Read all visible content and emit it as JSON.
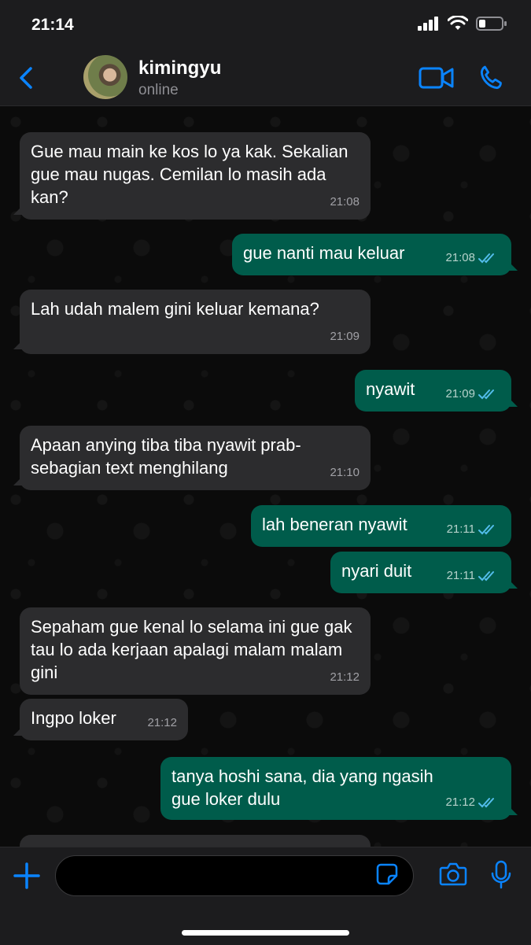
{
  "status_bar": {
    "time": "21:14"
  },
  "header": {
    "contact_name": "kimingyu",
    "status": "online"
  },
  "messages": [
    {
      "dir": "in",
      "text": "Gue mau main ke kos lo ya kak. Sekalian gue mau nugas. Cemilan lo masih ada kan?",
      "time": "21:08"
    },
    {
      "dir": "out",
      "text": "gue nanti mau keluar",
      "time": "21:08",
      "read": true
    },
    {
      "dir": "in",
      "text": "Lah udah malem gini keluar kemana?",
      "time": "21:09"
    },
    {
      "dir": "out",
      "text": "nyawit",
      "time": "21:09",
      "read": true
    },
    {
      "dir": "in",
      "text": "Apaan anying tiba tiba nyawit prab- sebagian text menghilang",
      "time": "21:10"
    },
    {
      "dir": "out",
      "text": "lah beneran nyawit",
      "time": "21:11",
      "read": true
    },
    {
      "dir": "out",
      "text": "nyari duit",
      "time": "21:11",
      "read": true
    },
    {
      "dir": "in",
      "text": "Sepaham gue kenal lo selama ini gue gak tau lo ada kerjaan apalagi malam malam gini",
      "time": "21:12"
    },
    {
      "dir": "in",
      "text": "Ingpo loker",
      "time": "21:12"
    },
    {
      "dir": "out",
      "text": "tanya hoshi sana, dia yang ngasih gue loker dulu",
      "time": "21:12",
      "read": true
    }
  ],
  "composer": {
    "input_value": "",
    "placeholder": ""
  },
  "icons": {
    "back": "chevron-left-icon",
    "video": "video-camera-icon",
    "call": "phone-icon",
    "plus": "plus-icon",
    "sticker": "sticker-icon",
    "camera": "camera-icon",
    "mic": "microphone-icon"
  },
  "colors": {
    "accent": "#0a84ff",
    "incoming_bubble": "#2c2c2e",
    "outgoing_bubble": "#005c4b",
    "read_ticks": "#53bdeb"
  }
}
